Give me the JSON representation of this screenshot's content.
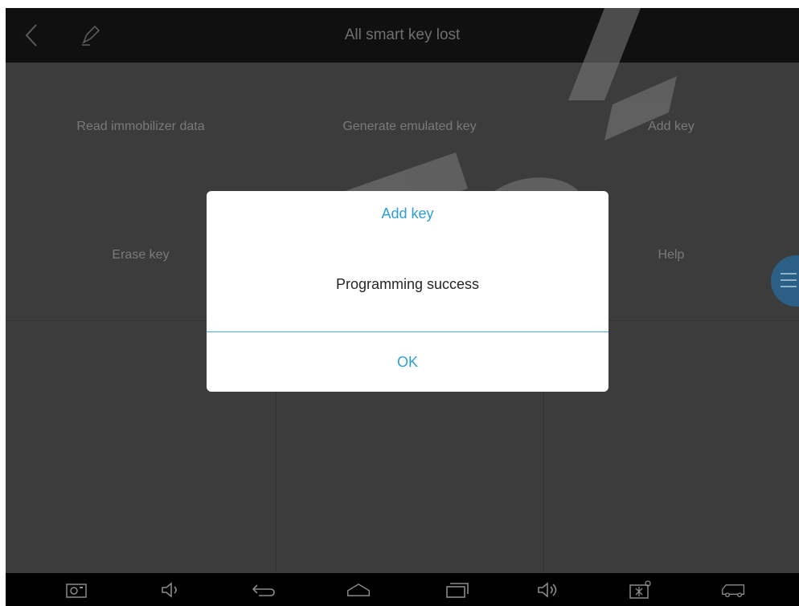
{
  "header": {
    "title": "All smart key lost",
    "back_icon": "back-chevron-icon",
    "edit_icon": "pen-icon"
  },
  "functions": [
    {
      "label": "Read immobilizer data"
    },
    {
      "label": "Generate emulated key"
    },
    {
      "label": "Add key"
    },
    {
      "label": "Erase key"
    },
    {
      "label": ""
    },
    {
      "label": "Help"
    }
  ],
  "floating_menu": {
    "icon": "menu-icon"
  },
  "dialog": {
    "title": "Add key",
    "message": "Programming success",
    "ok_label": "OK"
  },
  "navbar": {
    "icons": [
      "screenshot-icon",
      "volume-down-icon",
      "back-icon",
      "home-icon",
      "recent-apps-icon",
      "volume-up-icon",
      "vci-connection-icon",
      "truck-icon"
    ]
  },
  "colors": {
    "title_bar": "#101010",
    "background": "#3c3c3c",
    "accent": "#2b9fd8",
    "dialog_bg": "#ffffff"
  }
}
